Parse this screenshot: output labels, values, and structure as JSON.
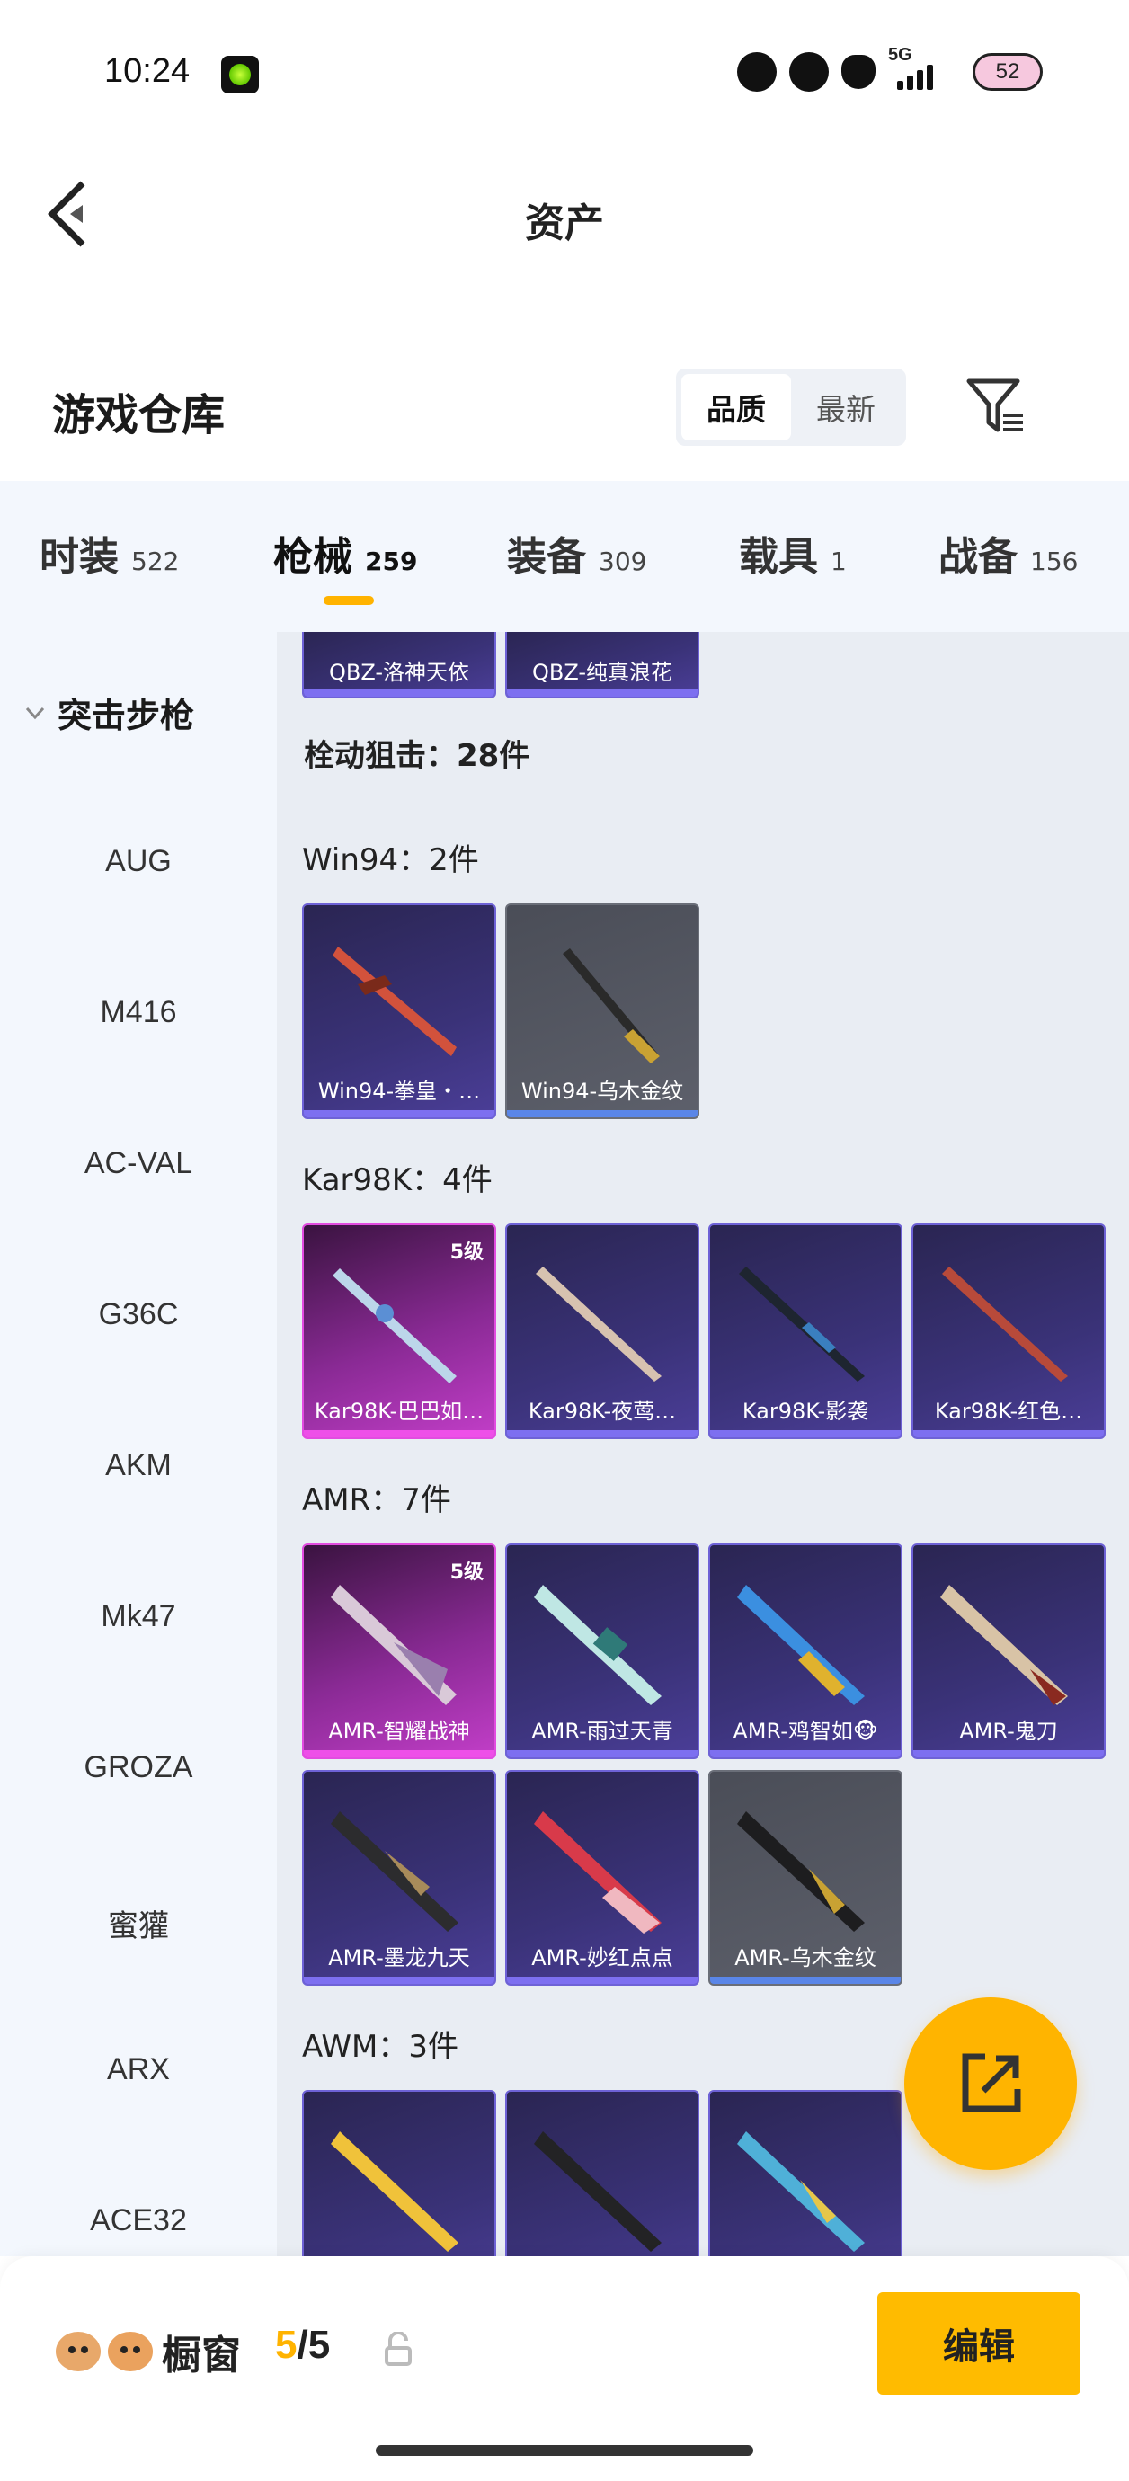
{
  "status_bar": {
    "time": "10:24",
    "network": "5G",
    "battery": "52"
  },
  "nav": {
    "title": "资产"
  },
  "warehouse": {
    "title": "游戏仓库",
    "sort_options": [
      "品质",
      "最新"
    ],
    "active_sort": "品质"
  },
  "tabs": [
    {
      "name": "时装",
      "count": "522"
    },
    {
      "name": "枪械",
      "count": "259",
      "active": true
    },
    {
      "name": "装备",
      "count": "309"
    },
    {
      "name": "载具",
      "count": "1"
    },
    {
      "name": "战备",
      "count": "156"
    }
  ],
  "sidebar": {
    "category": "突击步枪",
    "items": [
      "AUG",
      "M416",
      "AC-VAL",
      "G36C",
      "AKM",
      "Mk47",
      "GROZA",
      "蜜獾",
      "ARX",
      "ACE32"
    ]
  },
  "main": {
    "top_cards": [
      "QBZ-洛神天依",
      "QBZ-纯真浪花"
    ],
    "section_title": "栓动狙击：28件",
    "groups": [
      {
        "title": "Win94：2件",
        "cards": [
          {
            "label": "Win94-拳皇・…",
            "style": "purple"
          },
          {
            "label": "Win94-乌木金纹",
            "style": "gray"
          }
        ]
      },
      {
        "title": "Kar98K：4件",
        "cards": [
          {
            "label": "Kar98K-巴巴如…",
            "style": "pink",
            "level": "5级"
          },
          {
            "label": "Kar98K-夜莺…",
            "style": "purple"
          },
          {
            "label": "Kar98K-影袭",
            "style": "purple"
          },
          {
            "label": "Kar98K-红色…",
            "style": "purple"
          }
        ]
      },
      {
        "title": "AMR：7件",
        "cards": [
          {
            "label": "AMR-智耀战神",
            "style": "pink",
            "level": "5级"
          },
          {
            "label": "AMR-雨过天青",
            "style": "purple"
          },
          {
            "label": "AMR-鸡智如🐵",
            "style": "purple"
          },
          {
            "label": "AMR-鬼刀",
            "style": "purple"
          },
          {
            "label": "AMR-墨龙九天",
            "style": "purple"
          },
          {
            "label": "AMR-妙红点点",
            "style": "purple"
          },
          {
            "label": "AMR-乌木金纹",
            "style": "gray"
          }
        ]
      },
      {
        "title": "AWM：3件",
        "cards": [
          {
            "label": "",
            "style": "purple"
          },
          {
            "label": "",
            "style": "purple"
          },
          {
            "label": "",
            "style": "purple"
          }
        ]
      }
    ]
  },
  "bottom": {
    "window_label": "橱窗",
    "count_current": "5",
    "count_sep": "/",
    "count_max": "5",
    "edit_label": "编辑"
  },
  "colors": {
    "accent": "#ffb300",
    "tab_bg": "#f3f7fd",
    "content_bg": "#e9edf3"
  }
}
